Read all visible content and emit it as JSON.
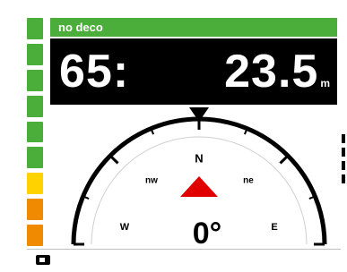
{
  "status": {
    "label": "no deco",
    "color": "#4cae3a"
  },
  "dive": {
    "dive_time": "65:",
    "depth": "23.5",
    "depth_unit": "m"
  },
  "ascent_rate": {
    "segments": [
      "#4cae3a",
      "#4cae3a",
      "#4cae3a",
      "#4cae3a",
      "#4cae3a",
      "#4cae3a",
      "#ffd200",
      "#f08a00",
      "#f08a00"
    ]
  },
  "compass": {
    "heading": "0°",
    "labels": {
      "n": "N",
      "nw": "nw",
      "ne": "ne",
      "w": "W",
      "e": "E"
    },
    "pointer_color": "#e00000"
  },
  "icons": {
    "heading_marker": "triangle-down-icon",
    "bottom_left": "battery-icon"
  }
}
